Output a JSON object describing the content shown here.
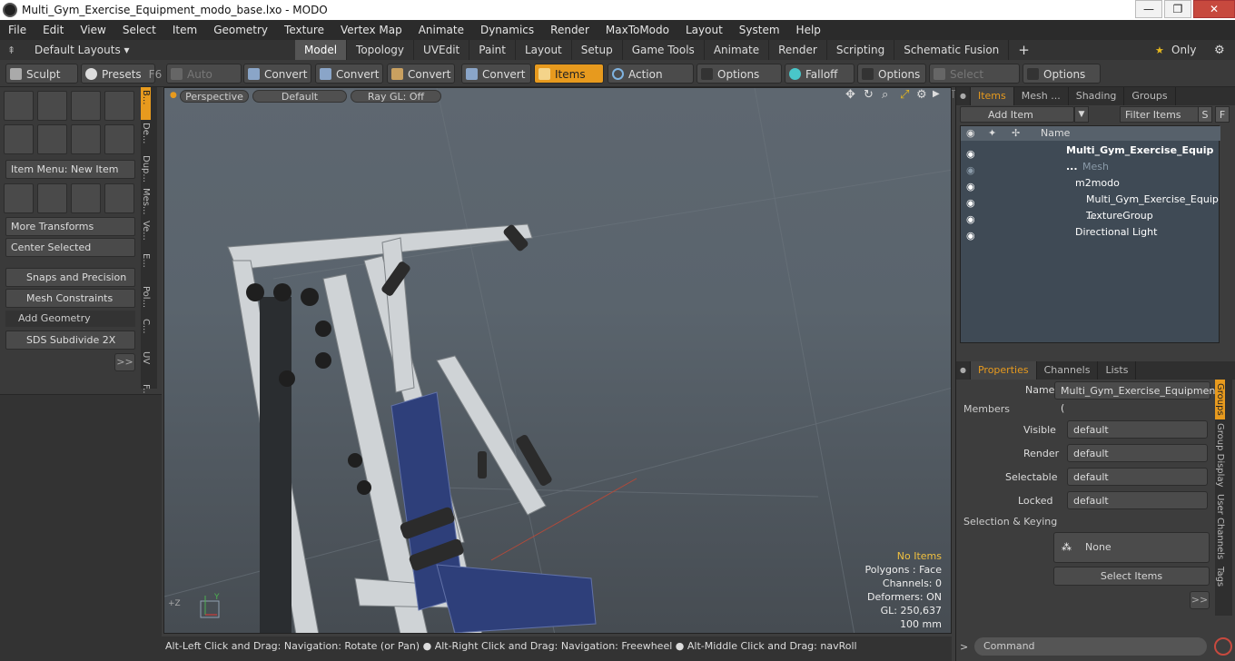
{
  "window": {
    "title": "Multi_Gym_Exercise_Equipment_modo_base.lxo - MODO",
    "min": "—",
    "max": "❐",
    "close": "✕"
  },
  "menu": [
    "File",
    "Edit",
    "View",
    "Select",
    "Item",
    "Geometry",
    "Texture",
    "Vertex Map",
    "Animate",
    "Dynamics",
    "Render",
    "MaxToModo",
    "Layout",
    "System",
    "Help"
  ],
  "layoutbar": {
    "layouts": "Default Layouts ▾",
    "tabs": [
      "Model",
      "Topology",
      "UVEdit",
      "Paint",
      "Layout",
      "Setup",
      "Game Tools",
      "Animate",
      "Render",
      "Scripting",
      "Schematic Fusion"
    ],
    "active": "Model",
    "plus": "+",
    "only": "Only",
    "star": "★",
    "gear": "⚙"
  },
  "toolbar": {
    "sculpt": "Sculpt",
    "presets": "Presets",
    "presets_key": "F6",
    "auto_select": "Auto Select",
    "convert1": "Convert",
    "convert2": "Convert",
    "convert3": "Convert",
    "convert4": "Convert",
    "items": "Items",
    "action_center": "Action Center",
    "options1": "Options",
    "falloff": "Falloff",
    "options2": "Options",
    "select_through": "Select Through",
    "options3": "Options"
  },
  "left": {
    "item_menu": "Item Menu: New Item",
    "more_transforms": "More Transforms",
    "center_selected": "Center Selected",
    "snaps": "Snaps and Precision",
    "mesh_constraints": "Mesh Constraints",
    "add_geometry": "Add Geometry",
    "sds": "SDS Subdivide 2X",
    "more": ">>"
  },
  "vtabs": [
    "B...",
    "De...",
    "Dup...",
    "Mes...",
    "Ve...",
    "E...",
    "Pol...",
    "C...",
    "UV",
    "F..."
  ],
  "viewport": {
    "view": "Perspective",
    "shading": "Default",
    "raygl": "Ray GL: Off",
    "info": [
      "No Items",
      "Polygons : Face",
      "Channels: 0",
      "Deformers: ON",
      "GL: 250,637",
      "100 mm"
    ],
    "axis_y": "Y",
    "axis_z": "+Z"
  },
  "status": "Alt-Left Click and Drag: Navigation: Rotate (or Pan) ● Alt-Right Click and Drag: Navigation: Freewheel ● Alt-Middle Click and Drag: navRoll",
  "right": {
    "tabs": [
      "Items",
      "Mesh ...",
      "Shading",
      "Groups"
    ],
    "add_item": "Add Item",
    "filter": "Filter Items",
    "s": "S",
    "f": "F",
    "col_name": "Name",
    "items": [
      {
        "label": "Multi_Gym_Exercise_Equip ...",
        "bold": true
      },
      {
        "label": "Mesh",
        "dim": true
      },
      {
        "label": "m2modo"
      },
      {
        "label": "Multi_Gym_Exercise_Equip ..."
      },
      {
        "label": "TextureGroup"
      },
      {
        "label": "Directional Light"
      }
    ],
    "ptabs": [
      "Properties",
      "Channels",
      "Lists"
    ],
    "name_label": "Name",
    "name_value": "Multi_Gym_Exercise_Equipment (",
    "members": "Members",
    "props": [
      {
        "label": "Visible",
        "value": "default"
      },
      {
        "label": "Render",
        "value": "default"
      },
      {
        "label": "Selectable",
        "value": "default"
      },
      {
        "label": "Locked",
        "value": "default"
      }
    ],
    "sel_keying": "Selection & Keying",
    "none": "None",
    "select_items": "Select Items",
    "more": ">>",
    "vtabs": [
      "Groups",
      "Group Display",
      "User Channels",
      "Tags"
    ],
    "command": "Command"
  }
}
